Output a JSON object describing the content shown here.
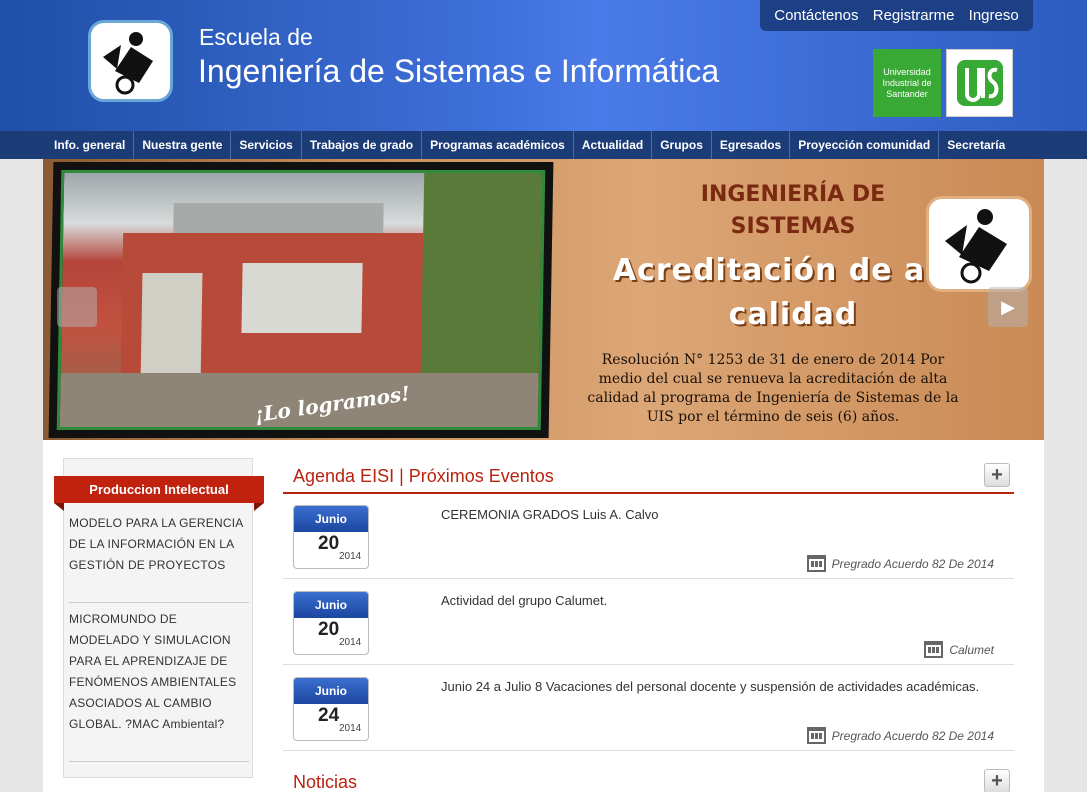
{
  "header": {
    "subtitle": "Escuela de",
    "title": "Ingeniería de Sistemas e Informática",
    "top_links": [
      "Contáctenos",
      "Registrarme",
      "Ingreso"
    ],
    "uis_badge": "Universidad Industrial de Santander",
    "uis_logo": "UIS"
  },
  "nav": [
    "Info. general",
    "Nuestra gente",
    "Servicios",
    "Trabajos de grado",
    "Programas académicos",
    "Actualidad",
    "Grupos",
    "Egresados",
    "Proyección comunidad",
    "Secretaría"
  ],
  "banner": {
    "photo_caption": "¡Lo logramos!",
    "heading": "INGENIERÍA DE SISTEMAS",
    "headline": "Acreditación de alta calidad",
    "resolution": "Resolución N° 1253 de 31 de enero de 2014 Por medio del cual se renueva la acreditación de alta calidad al programa de Ingeniería de Sistemas de la UIS por el término de seis (6) años."
  },
  "sidebar": {
    "title": "Produccion Intelectual",
    "items": [
      "MODELO PARA LA GERENCIA DE LA INFORMACIÓN EN LA GESTIÓN DE PROYECTOS",
      "MICROMUNDO DE MODELADO Y SIMULACION PARA EL APRENDIZAJE DE FENÓMENOS AMBIENTALES ASOCIADOS AL CAMBIO GLOBAL. ?MAC Ambiental?"
    ]
  },
  "agenda": {
    "title": "Agenda EISI | Próximos Eventos",
    "plus": "+",
    "events": [
      {
        "month": "Junio",
        "day": "20",
        "year": "2014",
        "title": "CEREMONIA GRADOS Luis A. Calvo",
        "category": "Pregrado Acuerdo 82 De 2014"
      },
      {
        "month": "Junio",
        "day": "20",
        "year": "2014",
        "title": "Actividad del grupo Calumet.",
        "category": "Calumet"
      },
      {
        "month": "Junio",
        "day": "24",
        "year": "2014",
        "title": "Junio 24 a Julio 8 Vacaciones del personal docente y suspensión de actividades académicas.",
        "category": "Pregrado Acuerdo 82 De 2014"
      }
    ]
  },
  "news": {
    "title": "Noticias",
    "plus": "+"
  },
  "colors": {
    "brand_red": "#b8230f",
    "header_blue": "#2d5cc0",
    "nav_blue": "#1c3c78",
    "uis_green": "#39a935"
  },
  "icons": {
    "prev_arrow": "arrow-left-icon",
    "next_arrow": "arrow-right-icon",
    "calendar": "calendar-icon"
  }
}
